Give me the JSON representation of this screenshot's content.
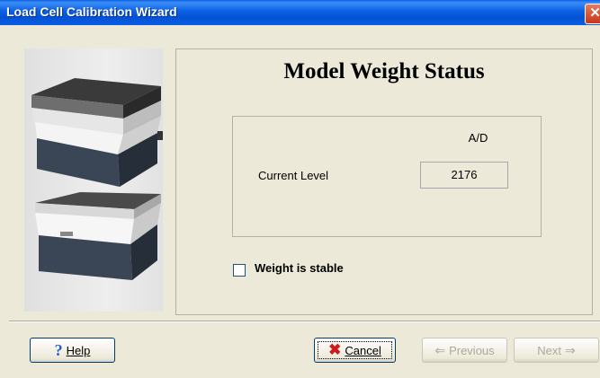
{
  "window": {
    "title": "Load Cell Calibration Wizard",
    "close_glyph": "✕"
  },
  "heading": "Model Weight Status",
  "readout": {
    "column_label": "A/D",
    "row_label": "Current Level",
    "value": "2176"
  },
  "stable_checkbox": {
    "label": "Weight is stable",
    "checked": false
  },
  "buttons": {
    "help": {
      "label": "Help",
      "icon": "question-mark-icon"
    },
    "cancel": {
      "label": "Cancel",
      "icon": "red-x-icon"
    },
    "previous": {
      "label": "Previous",
      "icon": "left-arrow-icon",
      "enabled": false
    },
    "next": {
      "label": "Next",
      "icon": "right-arrow-icon",
      "enabled": false
    }
  },
  "images": [
    "load-cell-device-top",
    "load-cell-device-bottom"
  ]
}
